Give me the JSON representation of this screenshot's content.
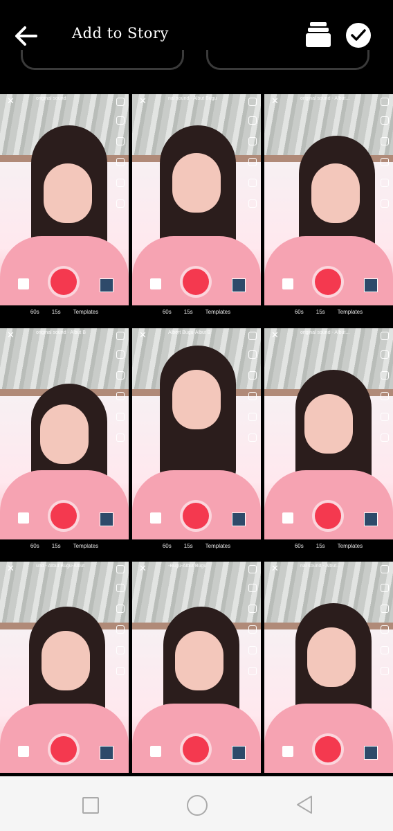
{
  "header": {
    "title": "Add to Story",
    "back_icon": "arrow-left-icon",
    "stack_icon": "stack-icon",
    "confirm_icon": "check-icon"
  },
  "grid": {
    "columns": 3,
    "rows": 3,
    "tiles": [
      {
        "sound": "original sound"
      },
      {
        "sound": "nal sound - Albut Bugu"
      },
      {
        "sound": "original sound - Albut..."
      },
      {
        "sound": "original sound - Albut B"
      },
      {
        "sound": "Albert Bugu-Albut B"
      },
      {
        "sound": "original sound - Albut..."
      },
      {
        "sound": "und - Albut Bugu-Albut"
      },
      {
        "sound": "-Bugu-Albut Bugu"
      },
      {
        "sound": "nal sound - Albut..."
      }
    ],
    "durations": [
      "60s",
      "15s",
      "Templates"
    ]
  },
  "navbar": {
    "recents_icon": "square-icon",
    "home_icon": "circle-icon",
    "back_icon": "triangle-back-icon"
  },
  "colors": {
    "background": "#000000",
    "record_button": "#f4394f",
    "navbar": "#f5f5f5"
  }
}
